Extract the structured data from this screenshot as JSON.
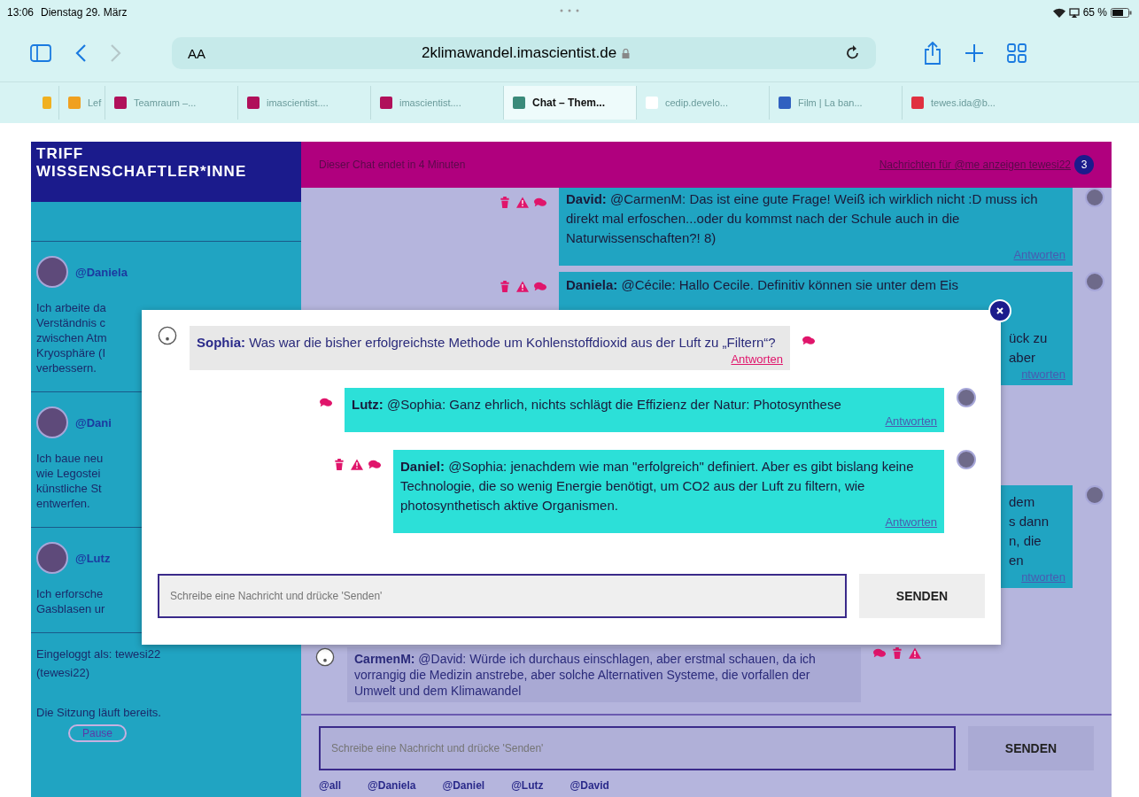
{
  "status_bar": {
    "time": "13:06",
    "date": "Dienstag 29. März",
    "battery": "65 %"
  },
  "toolbar": {
    "text_size": "AA",
    "url": "2klimawandel.imascientist.de"
  },
  "tabs": [
    {
      "label": "Lef",
      "selected": false,
      "color": "#f0a020"
    },
    {
      "label": "Teamraum –...",
      "selected": false,
      "color": "#b0105a"
    },
    {
      "label": "imascientist....",
      "selected": false,
      "color": "#b0105a"
    },
    {
      "label": "imascientist....",
      "selected": false,
      "color": "#b0105a"
    },
    {
      "label": "Chat – Them...",
      "selected": true,
      "color": "#3a8a7a"
    },
    {
      "label": "cedip.develo...",
      "selected": false,
      "color": "#ffffff"
    },
    {
      "label": "Film | La ban...",
      "selected": false,
      "color": "#3060c0"
    },
    {
      "label": "tewes.ida@b...",
      "selected": false,
      "color": "#e03040"
    }
  ],
  "sidebar": {
    "title": "TRIFF WISSENSCHAFTLER*INNE",
    "profiles": [
      {
        "name": "@Daniela",
        "bio_lines": [
          "Ich arbeite da",
          "Verständnis c",
          "zwischen Atm",
          "Kryosphäre (I",
          "verbessern."
        ]
      },
      {
        "name": "@Dani",
        "bio_lines": [
          "Ich baue neu",
          "wie Legostei",
          "künstliche St",
          "entwerfen."
        ]
      },
      {
        "name": "@Lutz",
        "bio_lines": [
          "Ich erforsche",
          "Gasblasen ur"
        ]
      }
    ],
    "login": "Eingeloggt als: tewesi22",
    "login_id": "(tewesi22)",
    "session": "Die Sitzung läuft bereits.",
    "pause_button": "Pause"
  },
  "chat_header": {
    "timer": "Dieser Chat endet in 4 Minuten",
    "messages_link": "Nachrichten für @me anzeigen tewesi22",
    "badge": "3"
  },
  "background_messages": [
    {
      "kind": "scientist",
      "moderation": true,
      "text": "**David:** @CarmenM: Das ist eine gute Frage! Weiß ich wirklich nicht :D muss ich direkt mal erfoschen...oder du kommst nach der Schule auch in die Naturwissenschaften?! 8)",
      "reply": "Antworten"
    },
    {
      "kind": "scientist",
      "moderation": true,
      "text": "**Daniela:** @Cécile: Hallo Cecile. Definitiv können sie unter dem Eis",
      "fragments": [
        "ück zu",
        "aber"
      ],
      "reply": "ntworten"
    },
    {
      "kind": "scientist",
      "moderation": false,
      "fragments": [
        "dem",
        "s dann",
        "n, die",
        "en"
      ],
      "reply": "ntworten"
    },
    {
      "kind": "student",
      "moderation": true,
      "text": "**CarmenM:** @David: Würde ich durchaus einschlagen, aber erstmal schauen, da ich vorrangig die Medizin anstrebe, aber solche Alternativen Systeme, die vorfallen der Umwelt und dem Klimawandel"
    }
  ],
  "composer": {
    "placeholder": "Schreibe eine Nachricht und drücke 'Senden'",
    "send_button": "SENDEN"
  },
  "mentions": [
    "@all",
    "@Daniela",
    "@Daniel",
    "@Lutz",
    "@David"
  ],
  "modal": {
    "messages": [
      {
        "kind": "student",
        "moderation": false,
        "text": "**Sophia:** Was war die bisher erfolgreichste Methode um Kohlenstoffdioxid aus der Luft zu „Filtern“?",
        "reply": "Antworten"
      },
      {
        "kind": "scientist",
        "moderation": false,
        "text": "**Lutz:** @Sophia: Ganz ehrlich, nichts schlägt die Effizienz der Natur: Photosynthese",
        "reply": "Antworten"
      },
      {
        "kind": "scientist",
        "moderation": true,
        "text": "**Daniel:** @Sophia: jenachdem wie man \"erfolgreich\" definiert. Aber es gibt bislang keine Technologie, die so wenig Energie benötigt, um CO2 aus der Luft zu filtern, wie photosynthetisch aktive Organismen.",
        "reply": "Antworten"
      }
    ],
    "placeholder": "Schreibe eine Nachricht und drücke 'Senden'",
    "send_button": "SENDEN"
  }
}
